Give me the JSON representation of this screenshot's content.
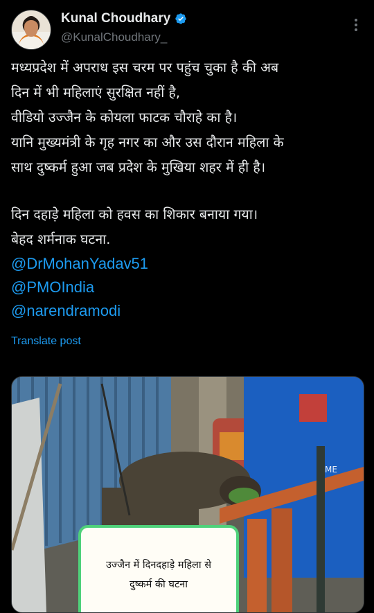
{
  "author": {
    "name": "Kunal Choudhary",
    "handle": "@KunalChoudhary_",
    "verified": true,
    "avatar_icon": "profile-photo"
  },
  "post": {
    "lines": [
      "मध्यप्रदेश में अपराध इस चरम पर पहुंच चुका है की अब",
      "दिन में भी महिलाएं सुरक्षित नहीं है,",
      "वीडियो उज्जैन के कोयला फाटक चौराहे का है।",
      "यानि मुख्यमंत्री के गृह नगर का और उस दौरान महिला के",
      "साथ दुष्कर्म हुआ जब प्रदेश के मुखिया शहर में ही है।"
    ],
    "lines2": [
      "दिन दहाड़े महिला को हवस का शिकार बनाया गया।",
      "बेहद शर्मनाक घटना."
    ],
    "mentions": [
      "@DrMohanYadav51",
      "@PMOIndia",
      "@narendramodi"
    ],
    "translate_label": "Translate post"
  },
  "media": {
    "caption_line1": "उज्जैन में दिनदहाड़े महिला से",
    "caption_line2": "दुष्कर्म की घटना",
    "bin_text": "ME"
  },
  "colors": {
    "background": "#000000",
    "text": "#e7e9ea",
    "secondary": "#71767b",
    "link": "#1d9bf0",
    "caption_border": "#4fd17a"
  }
}
